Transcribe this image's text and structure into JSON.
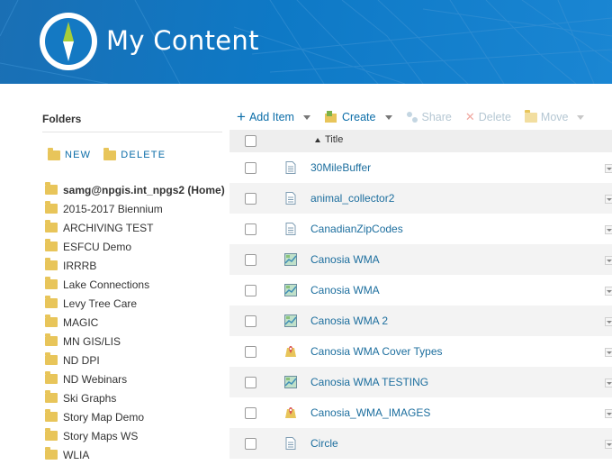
{
  "header": {
    "title": "My Content"
  },
  "folders": {
    "heading": "Folders",
    "new_label": "NEW",
    "delete_label": "DELETE",
    "items": [
      "samg@npgis.int_npgs2 (Home)",
      "2015-2017 Biennium",
      "ARCHIVING TEST",
      "ESFCU Demo",
      "IRRRB",
      "Lake Connections",
      "Levy Tree Care",
      "MAGIC",
      "MN GIS/LIS",
      "ND DPI",
      "ND Webinars",
      "Ski Graphs",
      "Story Map Demo",
      "Story Maps WS",
      "WLIA"
    ]
  },
  "toolbar": {
    "add_item": "Add Item",
    "create": "Create",
    "share": "Share",
    "delete": "Delete",
    "move": "Move"
  },
  "table": {
    "title_header": "Title",
    "rows": [
      {
        "title": "30MileBuffer",
        "icon": "document-icon"
      },
      {
        "title": "animal_collector2",
        "icon": "document-icon"
      },
      {
        "title": "CanadianZipCodes",
        "icon": "document-icon"
      },
      {
        "title": "Canosia WMA",
        "icon": "web-map-icon"
      },
      {
        "title": "Canosia WMA",
        "icon": "web-map-icon"
      },
      {
        "title": "Canosia WMA 2",
        "icon": "web-map-icon"
      },
      {
        "title": "Canosia WMA Cover Types",
        "icon": "map-service-icon"
      },
      {
        "title": "Canosia WMA TESTING",
        "icon": "web-map-icon"
      },
      {
        "title": "Canosia_WMA_IMAGES",
        "icon": "map-service-icon"
      },
      {
        "title": "Circle",
        "icon": "document-icon"
      }
    ]
  },
  "colors": {
    "header_blue": "#0e79c6",
    "link_blue": "#1c6e9e",
    "folder_yellow": "#e8c55a"
  }
}
